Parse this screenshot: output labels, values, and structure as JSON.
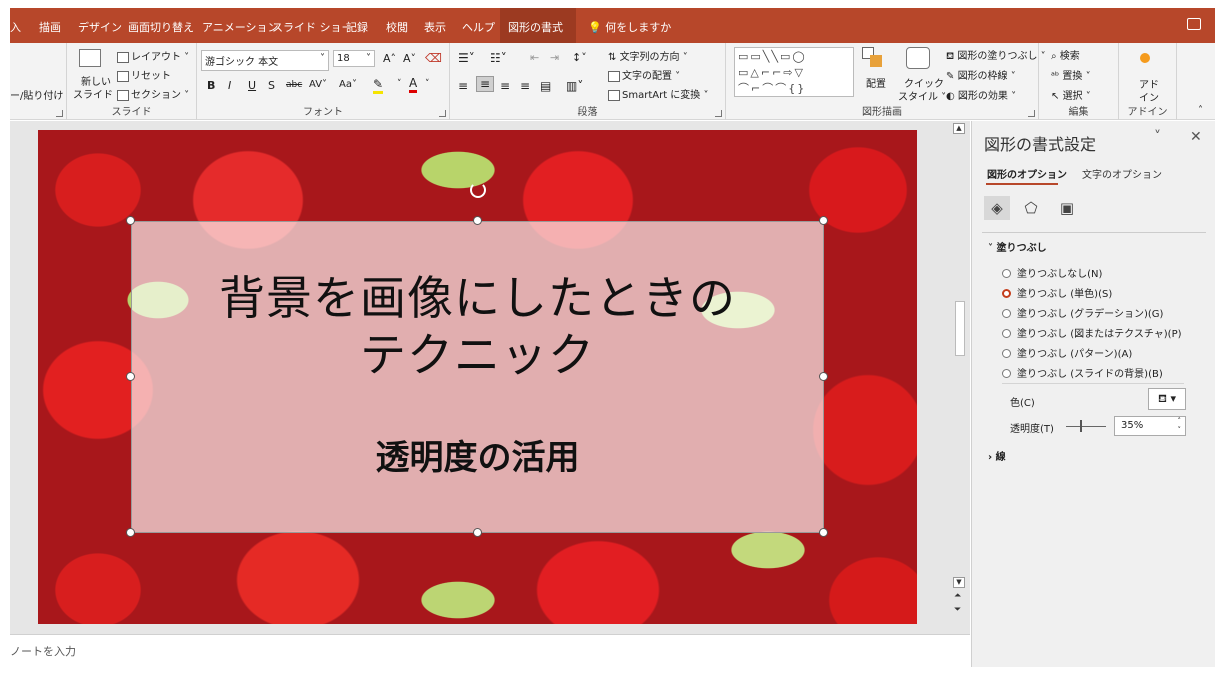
{
  "tabs": [
    "入",
    "描画",
    "デザイン",
    "画面切り替え",
    "アニメーション",
    "スライド ショー",
    "記録",
    "校閲",
    "表示",
    "ヘルプ",
    "図形の書式"
  ],
  "tell_me": "何をしますか",
  "ribbon": {
    "clipboard_paste": "ー/貼り付け",
    "slides": {
      "new_slide_line1": "新しい",
      "new_slide_line2": "スライド ˅",
      "layout": "レイアウト ˅",
      "reset": "リセット",
      "section": "セクション ˅",
      "label": "スライド"
    },
    "font": {
      "name": "游ゴシック 本文",
      "size": "18",
      "label": "フォント"
    },
    "paragraph": {
      "text_direction": "文字列の方向 ˅",
      "align_text": "文字の配置 ˅",
      "smartart": "SmartArt に変換 ˅",
      "label": "段落"
    },
    "drawing": {
      "arrange": "配置",
      "quick_styles_line1": "クイック",
      "quick_styles_line2": "スタイル ˅",
      "shape_fill": "図形の塗りつぶし ˅",
      "shape_outline": "図形の枠線 ˅",
      "shape_effects": "図形の効果 ˅",
      "label": "図形描画"
    },
    "editing": {
      "find": "検索",
      "replace": "置換 ˅",
      "select": "選択 ˅",
      "label": "編集"
    },
    "addins": {
      "line1": "アド",
      "line2": "イン",
      "label": "アドイン"
    }
  },
  "slide": {
    "title_line1": "背景を画像にしたときの",
    "title_line2": "テクニック",
    "subtitle": "透明度の活用"
  },
  "notes_placeholder": "ノートを入力",
  "pane": {
    "title": "図形の書式設定",
    "tab_shape": "図形のオプション",
    "tab_text": "文字のオプション",
    "fill_section": "塗りつぶし",
    "fill_options": [
      {
        "label": "塗りつぶしなし(N)",
        "selected": false
      },
      {
        "label": "塗りつぶし (単色)(S)",
        "selected": true
      },
      {
        "label": "塗りつぶし (グラデーション)(G)",
        "selected": false
      },
      {
        "label": "塗りつぶし (図またはテクスチャ)(P)",
        "selected": false
      },
      {
        "label": "塗りつぶし (パターン)(A)",
        "selected": false
      },
      {
        "label": "塗りつぶし (スライドの背景)(B)",
        "selected": false
      }
    ],
    "color_label": "色(C)",
    "transparency_label": "透明度(T)",
    "transparency_value": "35%",
    "line_section": "線"
  },
  "colors": {
    "accent": "#b7472a",
    "radio_selected": "#c43e1c"
  }
}
